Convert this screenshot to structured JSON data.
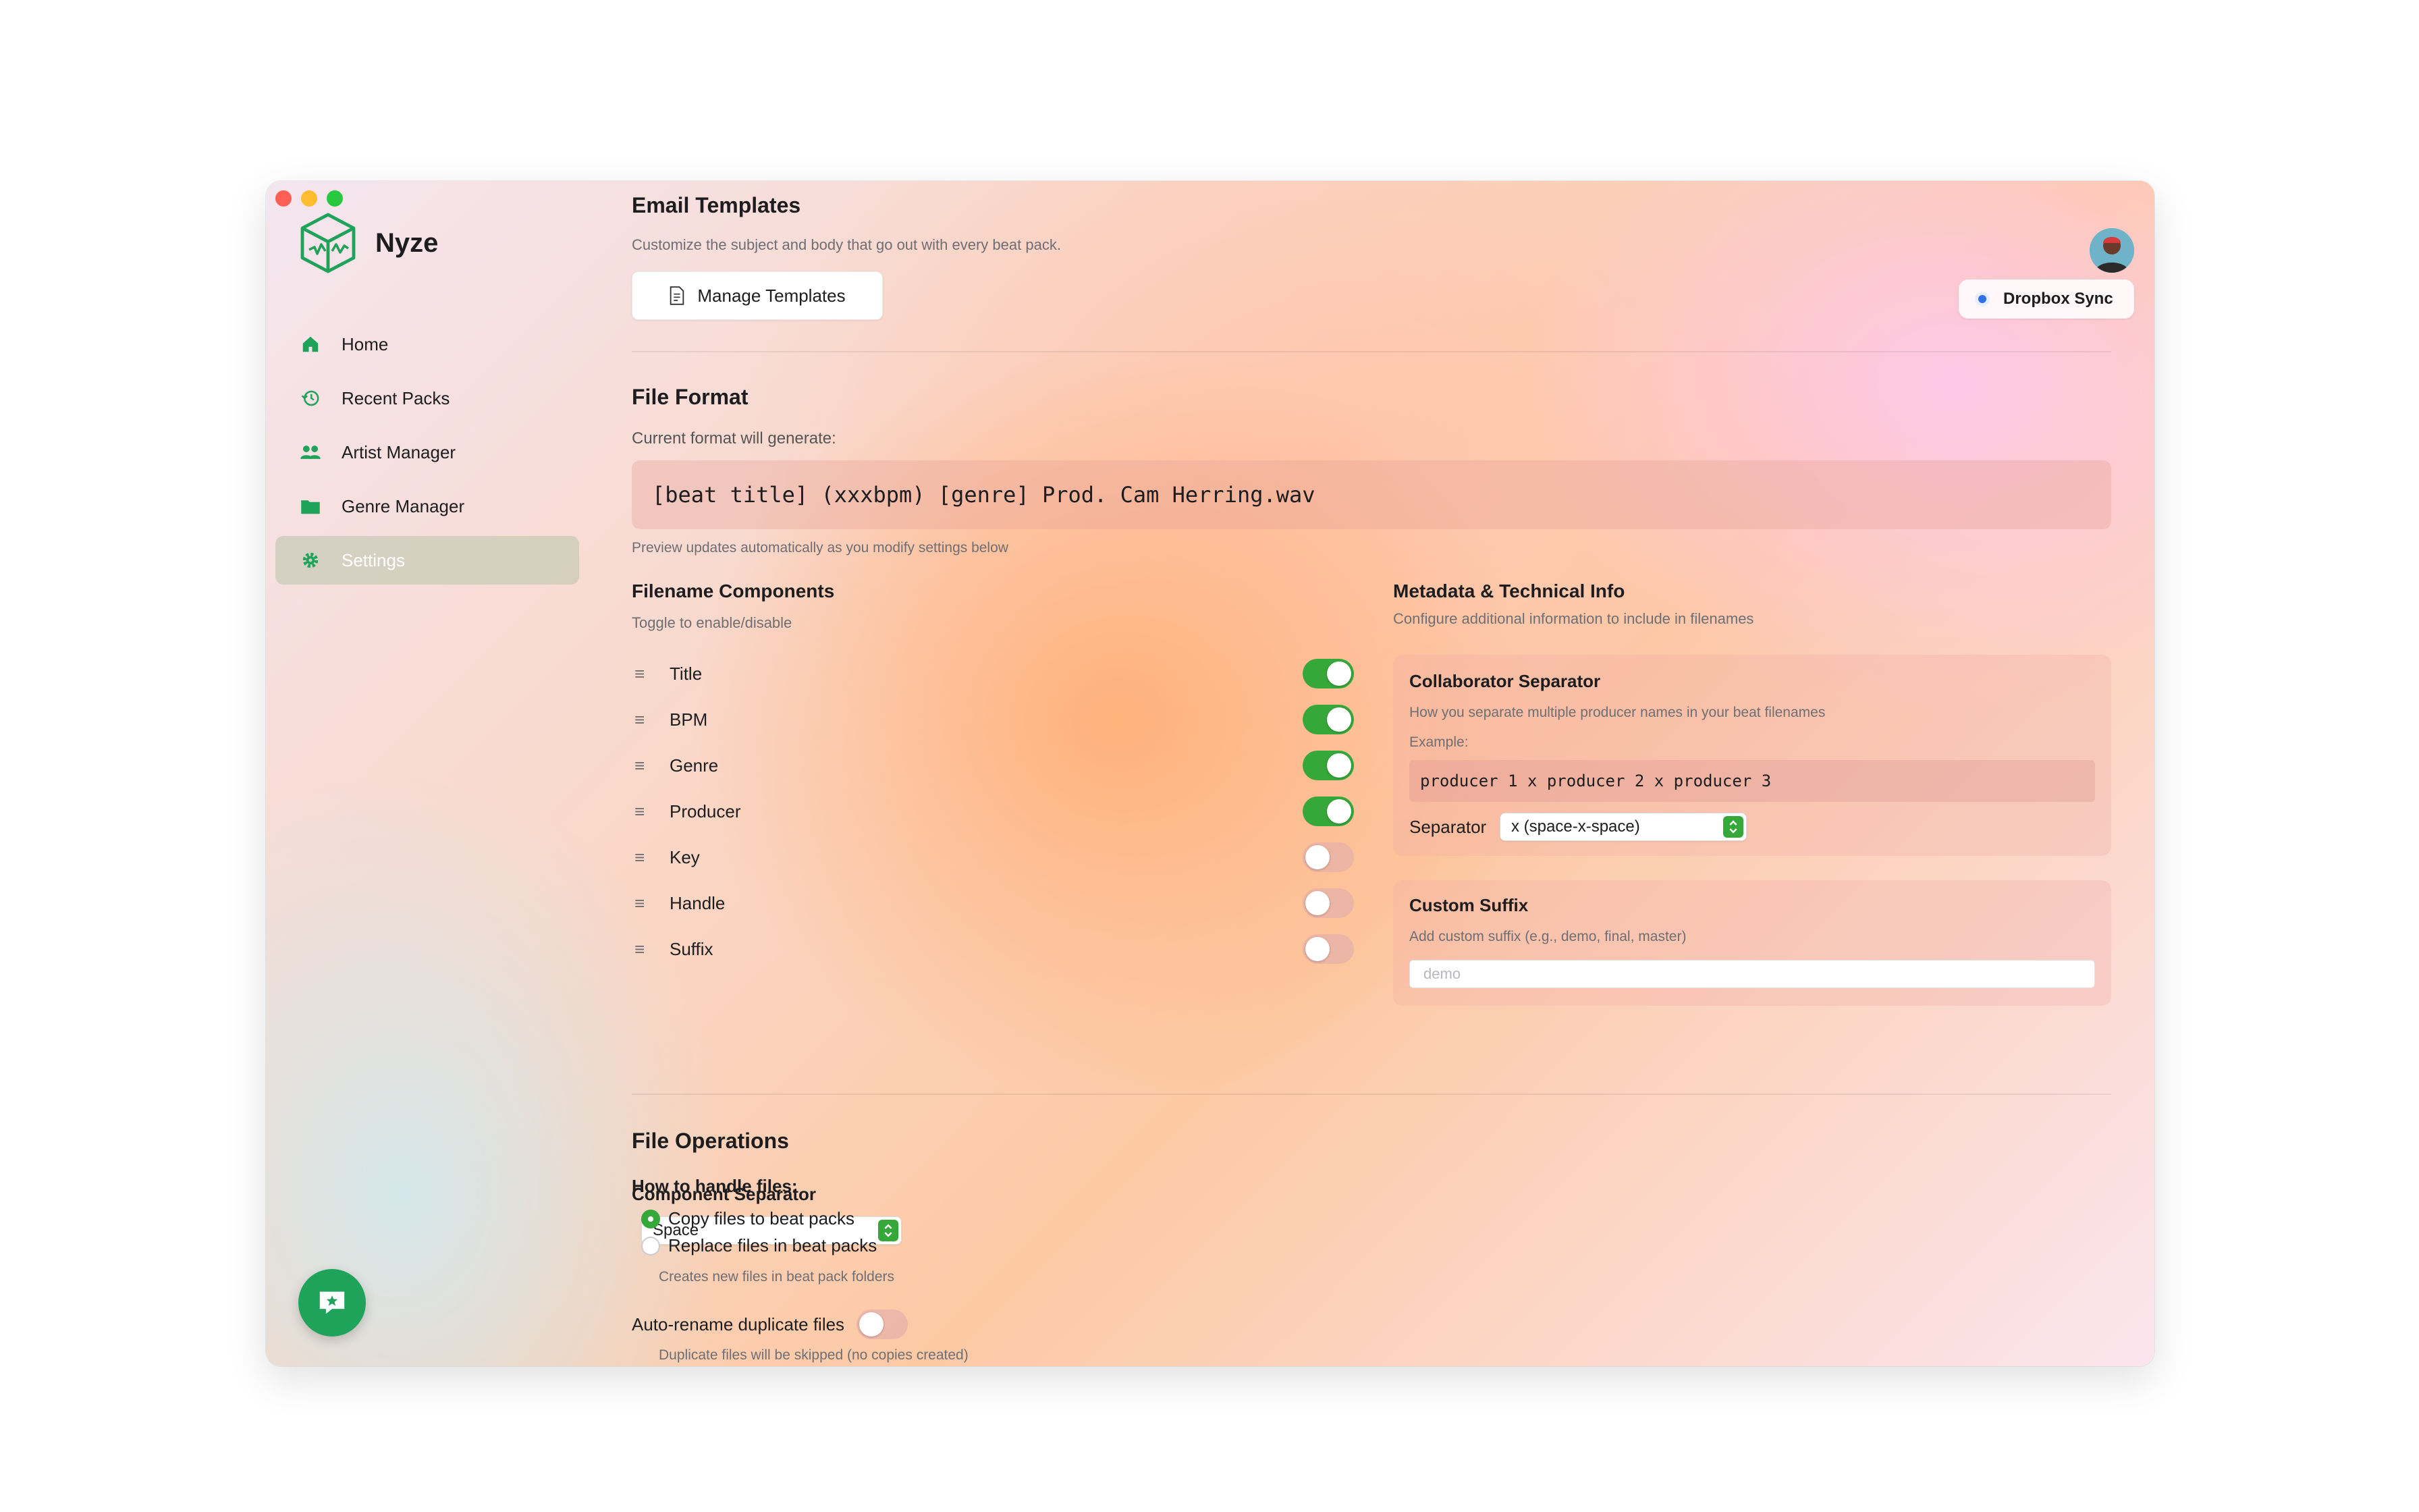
{
  "app": {
    "name": "Nyze"
  },
  "sidebar": {
    "items": [
      {
        "label": "Home",
        "icon": "home-icon",
        "active": false
      },
      {
        "label": "Recent Packs",
        "icon": "history-icon",
        "active": false
      },
      {
        "label": "Artist Manager",
        "icon": "people-icon",
        "active": false
      },
      {
        "label": "Genre Manager",
        "icon": "folder-icon",
        "active": false
      },
      {
        "label": "Settings",
        "icon": "gear-icon",
        "active": true
      }
    ],
    "help_icon": "chat-star-icon"
  },
  "topbar": {
    "sync_label": "Dropbox Sync"
  },
  "email_templates": {
    "title": "Email Templates",
    "subtitle": "Customize the subject and body that go out with every beat pack.",
    "button_label": "Manage Templates"
  },
  "file_format": {
    "title": "File Format",
    "current_label": "Current format will generate:",
    "preview": "[beat title] (xxxbpm) [genre] Prod. Cam Herring.wav",
    "hint": "Preview updates automatically as you modify settings below"
  },
  "filename_components": {
    "title": "Filename Components",
    "subtitle": "Toggle to enable/disable",
    "items": [
      {
        "label": "Title",
        "enabled": true
      },
      {
        "label": "BPM",
        "enabled": true
      },
      {
        "label": "Genre",
        "enabled": true
      },
      {
        "label": "Producer",
        "enabled": true
      },
      {
        "label": "Key",
        "enabled": false
      },
      {
        "label": "Handle",
        "enabled": false
      },
      {
        "label": "Suffix",
        "enabled": false
      }
    ],
    "separator_title": "Component Separator",
    "separator_value": "Space"
  },
  "metadata": {
    "title": "Metadata & Technical Info",
    "subtitle": "Configure additional information to include in filenames",
    "collaborator": {
      "title": "Collaborator Separator",
      "subtitle": "How you separate multiple producer names in your beat filenames",
      "example_label": "Example:",
      "example": "producer 1 x producer 2 x producer 3",
      "separator_label": "Separator",
      "separator_value": "x (space-x-space)"
    },
    "suffix": {
      "title": "Custom Suffix",
      "subtitle": "Add custom suffix (e.g., demo, final, master)",
      "placeholder": "demo"
    }
  },
  "file_operations": {
    "title": "File Operations",
    "how_label": "How to handle files:",
    "options": [
      {
        "label": "Copy files to beat packs",
        "selected": true
      },
      {
        "label": "Replace files in beat packs",
        "selected": false
      }
    ],
    "option_hint": "Creates new files in beat pack folders",
    "auto_rename_label": "Auto-rename duplicate files",
    "auto_rename_enabled": false,
    "auto_rename_hint": "Duplicate files will be skipped (no copies created)"
  },
  "colors": {
    "accent_green": "#36a83a",
    "brand_green": "#1fa35a",
    "sync_blue": "#2f6fe8"
  }
}
